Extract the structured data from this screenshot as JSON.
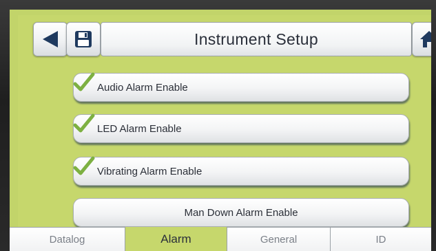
{
  "header": {
    "title": "Instrument Setup",
    "back_icon": "back-arrow-icon",
    "save_icon": "floppy-disk-icon",
    "home_icon": "home-icon"
  },
  "options": [
    {
      "label": "Audio Alarm Enable",
      "checked": true
    },
    {
      "label": "LED Alarm Enable",
      "checked": true
    },
    {
      "label": "Vibrating Alarm Enable",
      "checked": true
    },
    {
      "label": "Man Down Alarm Enable",
      "checked": false
    }
  ],
  "tabs": [
    {
      "label": "Datalog",
      "active": false
    },
    {
      "label": "Alarm",
      "active": true
    },
    {
      "label": "General",
      "active": false
    },
    {
      "label": "ID",
      "active": false
    }
  ],
  "colors": {
    "screen_bg": "#c6d76c",
    "check_green": "#7db042",
    "icon_navy": "#1f3a5f"
  }
}
